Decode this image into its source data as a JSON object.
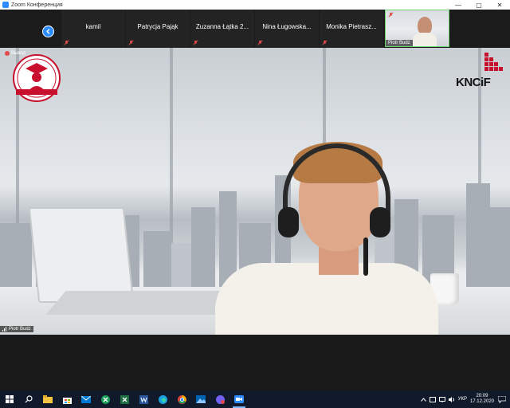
{
  "window": {
    "title": "Zoom Конференция",
    "controls": [
      "—",
      "▢",
      "✕"
    ]
  },
  "participants": [
    {
      "name": "kamil",
      "muted": true
    },
    {
      "name": "Patrycja Pająk",
      "muted": true
    },
    {
      "name": "Zuzanna Łątka 2...",
      "muted": true
    },
    {
      "name": "Nina Ługowska...",
      "muted": true
    },
    {
      "name": "Monika Pietrasz...",
      "muted": true
    }
  ],
  "self_tile": {
    "name": "Piotr Budz"
  },
  "main_video": {
    "viewing_label": "Вывод",
    "speaker_name": "Piotr Budz",
    "logo_right_text": "KNCiF"
  },
  "taskbar": {
    "language": "УКР",
    "time": "20:09",
    "date": "17.12.2020",
    "notification_count": "1",
    "apps": [
      "start-icon",
      "search-icon",
      "file-explorer-icon",
      "store-icon",
      "mail-icon",
      "excel-icon",
      "sheets-icon",
      "word-icon",
      "edge-icon",
      "chrome-icon",
      "photos-icon",
      "viber-icon",
      "zoom-icon"
    ]
  },
  "colors": {
    "accent": "#2d8cff",
    "mic_muted": "#e34b4b",
    "active_speaker": "#6cd46c"
  }
}
